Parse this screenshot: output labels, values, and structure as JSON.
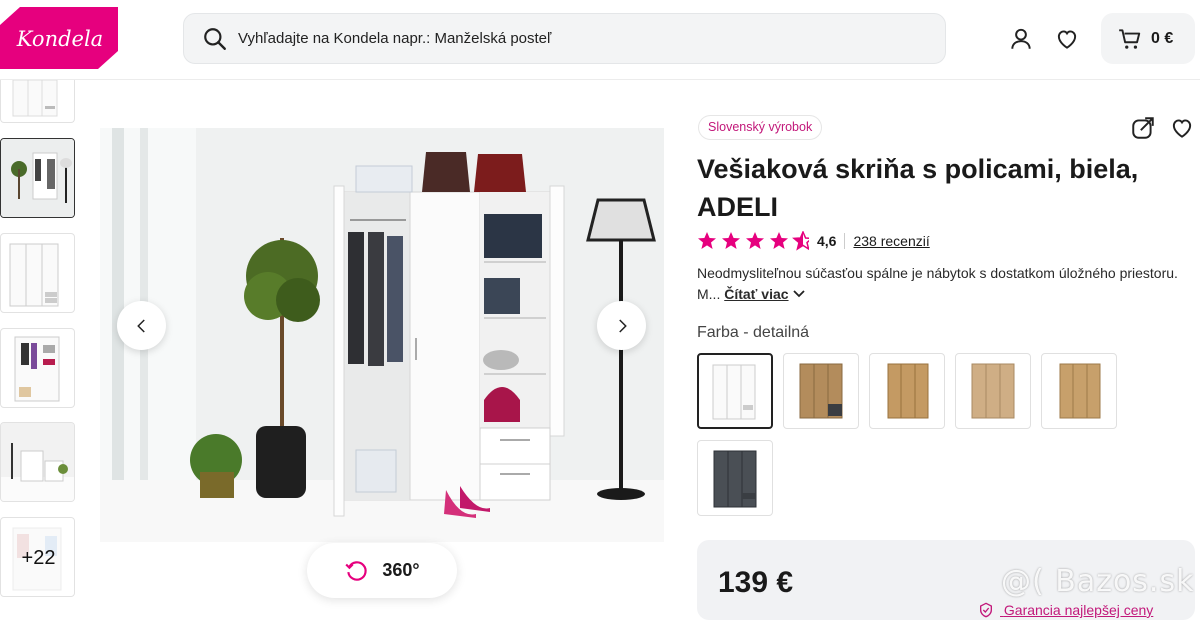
{
  "header": {
    "logo_text": "Kondela",
    "search_placeholder": "Vyhľadajte na Kondela napr.: Manželská posteľ",
    "cart_total": "0 €",
    "icons": [
      "search-icon",
      "user-icon",
      "heart-icon",
      "cart-icon"
    ]
  },
  "gallery": {
    "thumbnail_more": "+22",
    "btn_360": "360°",
    "icons": [
      "chevron-left-icon",
      "chevron-right-icon",
      "rotate-icon"
    ]
  },
  "product": {
    "badge": "Slovenský výrobok",
    "title": "Vešiaková skriňa s policami, biela, ADELI",
    "rating_value": 4.6,
    "rating_text": "4,6",
    "reviews": "238 recenzií",
    "description": "Neodmysliteľnou súčasťou spálne je nábytok s dostatkom úložného priestoru. M...",
    "read_more": "Čítať viac",
    "color_label": "Farba - detailná",
    "price": "139 €",
    "guarantee": "Garancia najlepšej ceny"
  },
  "watermark": "@( Bazos.sk",
  "colors": {
    "brand": "#e6007e",
    "star": "#e6007e",
    "text": "#1a1a1a",
    "panel": "#f1f2f4"
  },
  "swatches": [
    {
      "name": "white",
      "color": "#f5f5f5",
      "selected": true
    },
    {
      "name": "oak-dark",
      "color": "#b38c5c",
      "selected": false
    },
    {
      "name": "oak",
      "color": "#c49a63",
      "selected": false
    },
    {
      "name": "sonoma",
      "color": "#cfae85",
      "selected": false
    },
    {
      "name": "oak-light",
      "color": "#c7a06b",
      "selected": false
    },
    {
      "name": "graphite",
      "color": "#4a4f55",
      "selected": false
    }
  ]
}
